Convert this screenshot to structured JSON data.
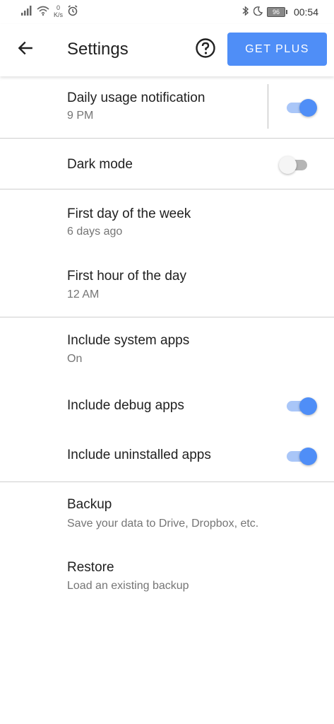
{
  "status_bar": {
    "net_speed_value": "0",
    "net_speed_unit": "K/s",
    "battery": "96",
    "time": "00:54"
  },
  "app_bar": {
    "title": "Settings",
    "get_plus_label": "GET PLUS"
  },
  "settings": {
    "daily_usage": {
      "title": "Daily usage notification",
      "subtitle": "9 PM",
      "enabled": true
    },
    "dark_mode": {
      "title": "Dark mode",
      "enabled": false
    },
    "first_day": {
      "title": "First day of the week",
      "subtitle": "6 days ago"
    },
    "first_hour": {
      "title": "First hour of the day",
      "subtitle": "12 AM"
    },
    "system_apps": {
      "title": "Include system apps",
      "subtitle": "On"
    },
    "debug_apps": {
      "title": "Include debug apps",
      "enabled": true
    },
    "uninstalled_apps": {
      "title": "Include uninstalled apps",
      "enabled": true
    },
    "backup": {
      "title": "Backup",
      "subtitle": "Save your data to Drive, Dropbox, etc."
    },
    "restore": {
      "title": "Restore",
      "subtitle": "Load an existing backup"
    }
  },
  "colors": {
    "accent": "#4f8ef7",
    "toggle_track_on": "#a9c6f8",
    "divider": "#cfcfcf"
  }
}
